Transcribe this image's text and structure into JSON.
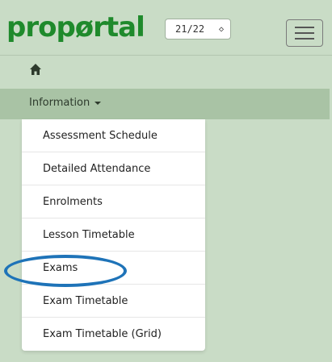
{
  "header": {
    "logo_text": "propørtal",
    "year_select": {
      "value": "21/22"
    }
  },
  "nav": {
    "information_label": "Information"
  },
  "dropdown": {
    "items": [
      {
        "label": "Assessment Schedule"
      },
      {
        "label": "Detailed Attendance"
      },
      {
        "label": "Enrolments"
      },
      {
        "label": "Lesson Timetable"
      },
      {
        "label": "Exams"
      },
      {
        "label": "Exam Timetable"
      },
      {
        "label": "Exam Timetable (Grid)"
      }
    ]
  },
  "colors": {
    "brand_green": "#1f8a2c",
    "background": "#c9dcc6",
    "nav_bar": "#a9c3a5",
    "highlight": "#1e73b8"
  },
  "icons": {
    "home": "home-icon",
    "menu": "hamburger-menu-icon",
    "select_arrows": "up-down-arrows-icon",
    "dropdown_caret": "caret-down-icon"
  }
}
